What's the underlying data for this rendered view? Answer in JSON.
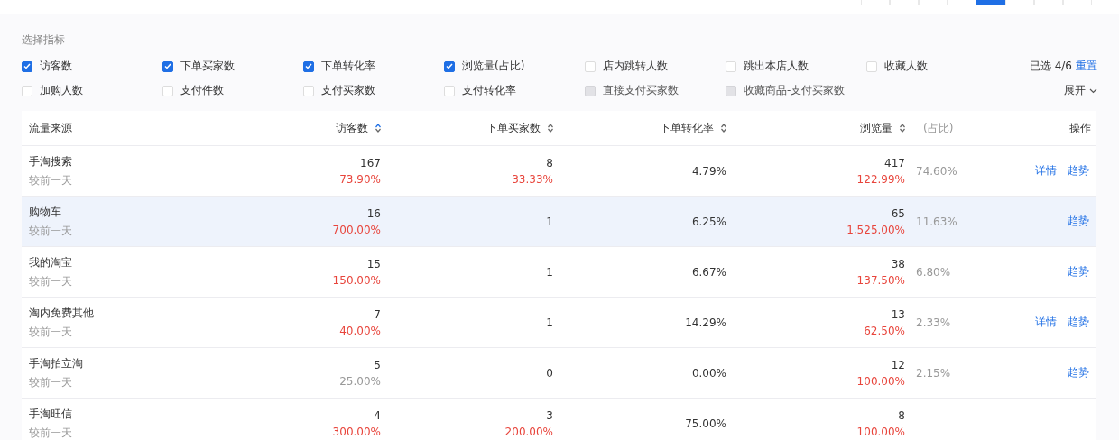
{
  "top_segments": [
    {
      "selected": false
    },
    {
      "selected": false
    },
    {
      "selected": false
    },
    {
      "selected": false
    },
    {
      "selected": true
    },
    {
      "selected": false
    },
    {
      "selected": false
    },
    {
      "selected": false
    }
  ],
  "filter": {
    "title": "选择指标",
    "summary": "已选 4/6",
    "reset": "重置",
    "expand": "展开",
    "options": [
      {
        "label": "访客数",
        "checked": true,
        "disabled": false
      },
      {
        "label": "下单买家数",
        "checked": true,
        "disabled": false
      },
      {
        "label": "下单转化率",
        "checked": true,
        "disabled": false
      },
      {
        "label": "浏览量(占比)",
        "checked": true,
        "disabled": false
      },
      {
        "label": "店内跳转人数",
        "checked": false,
        "disabled": false
      },
      {
        "label": "跳出本店人数",
        "checked": false,
        "disabled": false
      },
      {
        "label": "收藏人数",
        "checked": false,
        "disabled": false
      },
      {
        "label": "加购人数",
        "checked": false,
        "disabled": false
      },
      {
        "label": "支付件数",
        "checked": false,
        "disabled": false
      },
      {
        "label": "支付买家数",
        "checked": false,
        "disabled": false
      },
      {
        "label": "支付转化率",
        "checked": false,
        "disabled": false
      },
      {
        "label": "直接支付买家数",
        "checked": false,
        "disabled": true
      },
      {
        "label": "收藏商品-支付买家数",
        "checked": false,
        "disabled": true
      }
    ]
  },
  "table": {
    "columns": [
      {
        "label": "流量来源",
        "sortable": false
      },
      {
        "label": "访客数",
        "sortable": true,
        "sorted": true
      },
      {
        "label": "下单买家数",
        "sortable": true,
        "sorted": false
      },
      {
        "label": "下单转化率",
        "sortable": true,
        "sorted": false
      },
      {
        "label": "浏览量",
        "sortable": true,
        "sorted": false,
        "note": "(占比)"
      },
      {
        "label": "操作",
        "sortable": false
      }
    ],
    "rows": [
      {
        "source": "手淘搜索",
        "compare": "较前一天",
        "selected": false,
        "visitors": {
          "value": "167",
          "change": "73.90%",
          "kind": "rise"
        },
        "buyers": {
          "value": "8",
          "change": "33.33%",
          "kind": "rise"
        },
        "conversion": "4.79%",
        "views": {
          "value": "417",
          "change": "122.99%",
          "kind": "rise"
        },
        "share": "74.60%",
        "actions": [
          "详情",
          "趋势"
        ]
      },
      {
        "source": "购物车",
        "compare": "较前一天",
        "selected": true,
        "visitors": {
          "value": "16",
          "change": "700.00%",
          "kind": "rise"
        },
        "buyers": {
          "value": "1"
        },
        "conversion": "6.25%",
        "views": {
          "value": "65",
          "change": "1,525.00%",
          "kind": "rise"
        },
        "share": "11.63%",
        "actions": [
          "趋势"
        ]
      },
      {
        "source": "我的淘宝",
        "compare": "较前一天",
        "selected": false,
        "visitors": {
          "value": "15",
          "change": "150.00%",
          "kind": "rise"
        },
        "buyers": {
          "value": "1"
        },
        "conversion": "6.67%",
        "views": {
          "value": "38",
          "change": "137.50%",
          "kind": "rise"
        },
        "share": "6.80%",
        "actions": [
          "趋势"
        ]
      },
      {
        "source": "淘内免费其他",
        "compare": "较前一天",
        "selected": false,
        "visitors": {
          "value": "7",
          "change": "40.00%",
          "kind": "rise"
        },
        "buyers": {
          "value": "1"
        },
        "conversion": "14.29%",
        "views": {
          "value": "13",
          "change": "62.50%",
          "kind": "rise"
        },
        "share": "2.33%",
        "actions": [
          "详情",
          "趋势"
        ]
      },
      {
        "source": "手淘拍立淘",
        "compare": "较前一天",
        "selected": false,
        "visitors": {
          "value": "5",
          "change": "25.00%",
          "kind": "fall"
        },
        "buyers": {
          "value": "0"
        },
        "conversion": "0.00%",
        "views": {
          "value": "12",
          "change": "100.00%",
          "kind": "rise"
        },
        "share": "2.15%",
        "actions": [
          "趋势"
        ]
      },
      {
        "source": "手淘旺信",
        "compare": "较前一天",
        "selected": false,
        "visitors": {
          "value": "4",
          "change": "300.00%",
          "kind": "rise"
        },
        "buyers": {
          "value": "3",
          "change": "200.00%",
          "kind": "rise"
        },
        "conversion": "75.00%",
        "views": {
          "value": "8",
          "change": "100.00%",
          "kind": "rise"
        }
      }
    ]
  }
}
